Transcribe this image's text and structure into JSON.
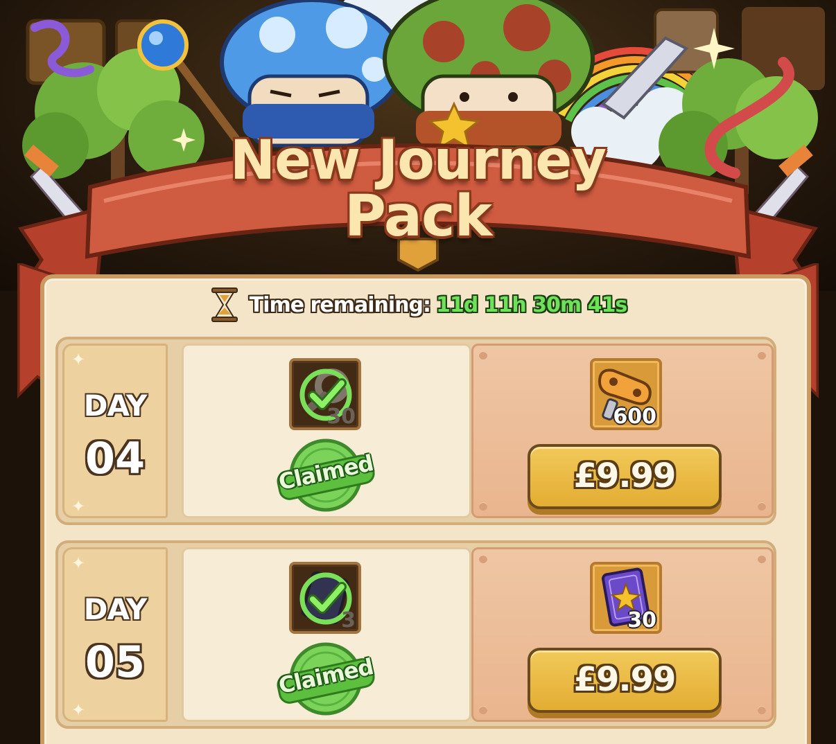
{
  "pack": {
    "title_line1": "New Journey",
    "title_line2": "Pack"
  },
  "timer": {
    "label": "Time remaining:",
    "value": "11d 11h 30m 41s"
  },
  "days": [
    {
      "day_word": "DAY",
      "day_number": "04",
      "free_reward": {
        "icon": "key-icon",
        "quantity": "30",
        "status": "Claimed"
      },
      "paid_reward": {
        "icon": "wind-up-key-icon",
        "quantity": "600",
        "price": "£9.99"
      }
    },
    {
      "day_word": "DAY",
      "day_number": "05",
      "free_reward": {
        "icon": "book-icon",
        "quantity": "3",
        "status": "Claimed"
      },
      "paid_reward": {
        "icon": "star-card-icon",
        "quantity": "30",
        "price": "£9.99"
      }
    }
  ],
  "colors": {
    "panel_bg": "#f4e5c9",
    "ribbon": "#c8533a",
    "title_fill": "#fbe6b0",
    "timer_green": "#6ee05a",
    "price_button": "#e3ad32",
    "claimed_green": "#6ccd4a"
  }
}
